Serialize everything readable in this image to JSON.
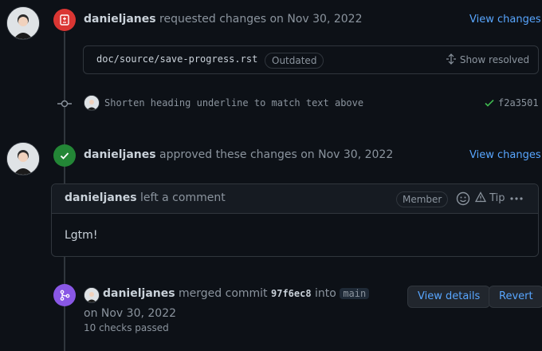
{
  "event1": {
    "author": "danieljanes",
    "action": "requested changes on Nov 30, 2022",
    "view_changes": "View changes",
    "file_path": "doc/source/save-progress.rst",
    "outdated_label": "Outdated",
    "show_resolved": "Show resolved"
  },
  "commit": {
    "message": "Shorten heading underline to match text above",
    "sha": "f2a3501"
  },
  "event2": {
    "author": "danieljanes",
    "action": "approved these changes on Nov 30, 2022",
    "view_changes": "View changes"
  },
  "comment": {
    "author": "danieljanes",
    "action": "left a comment",
    "role_badge": "Member",
    "tip_label": "Tip",
    "body": "Lgtm!"
  },
  "merge": {
    "author": "danieljanes",
    "action": "merged commit",
    "commit_sha": "97f6ec8",
    "into": "into",
    "branch": "main",
    "date": "on Nov 30, 2022",
    "checks": "10 checks passed",
    "view_details": "View details",
    "revert": "Revert"
  },
  "colors": {
    "requested_changes": "#da3633",
    "approved": "#238636",
    "merged": "#8957e5",
    "link": "#58a6ff"
  }
}
